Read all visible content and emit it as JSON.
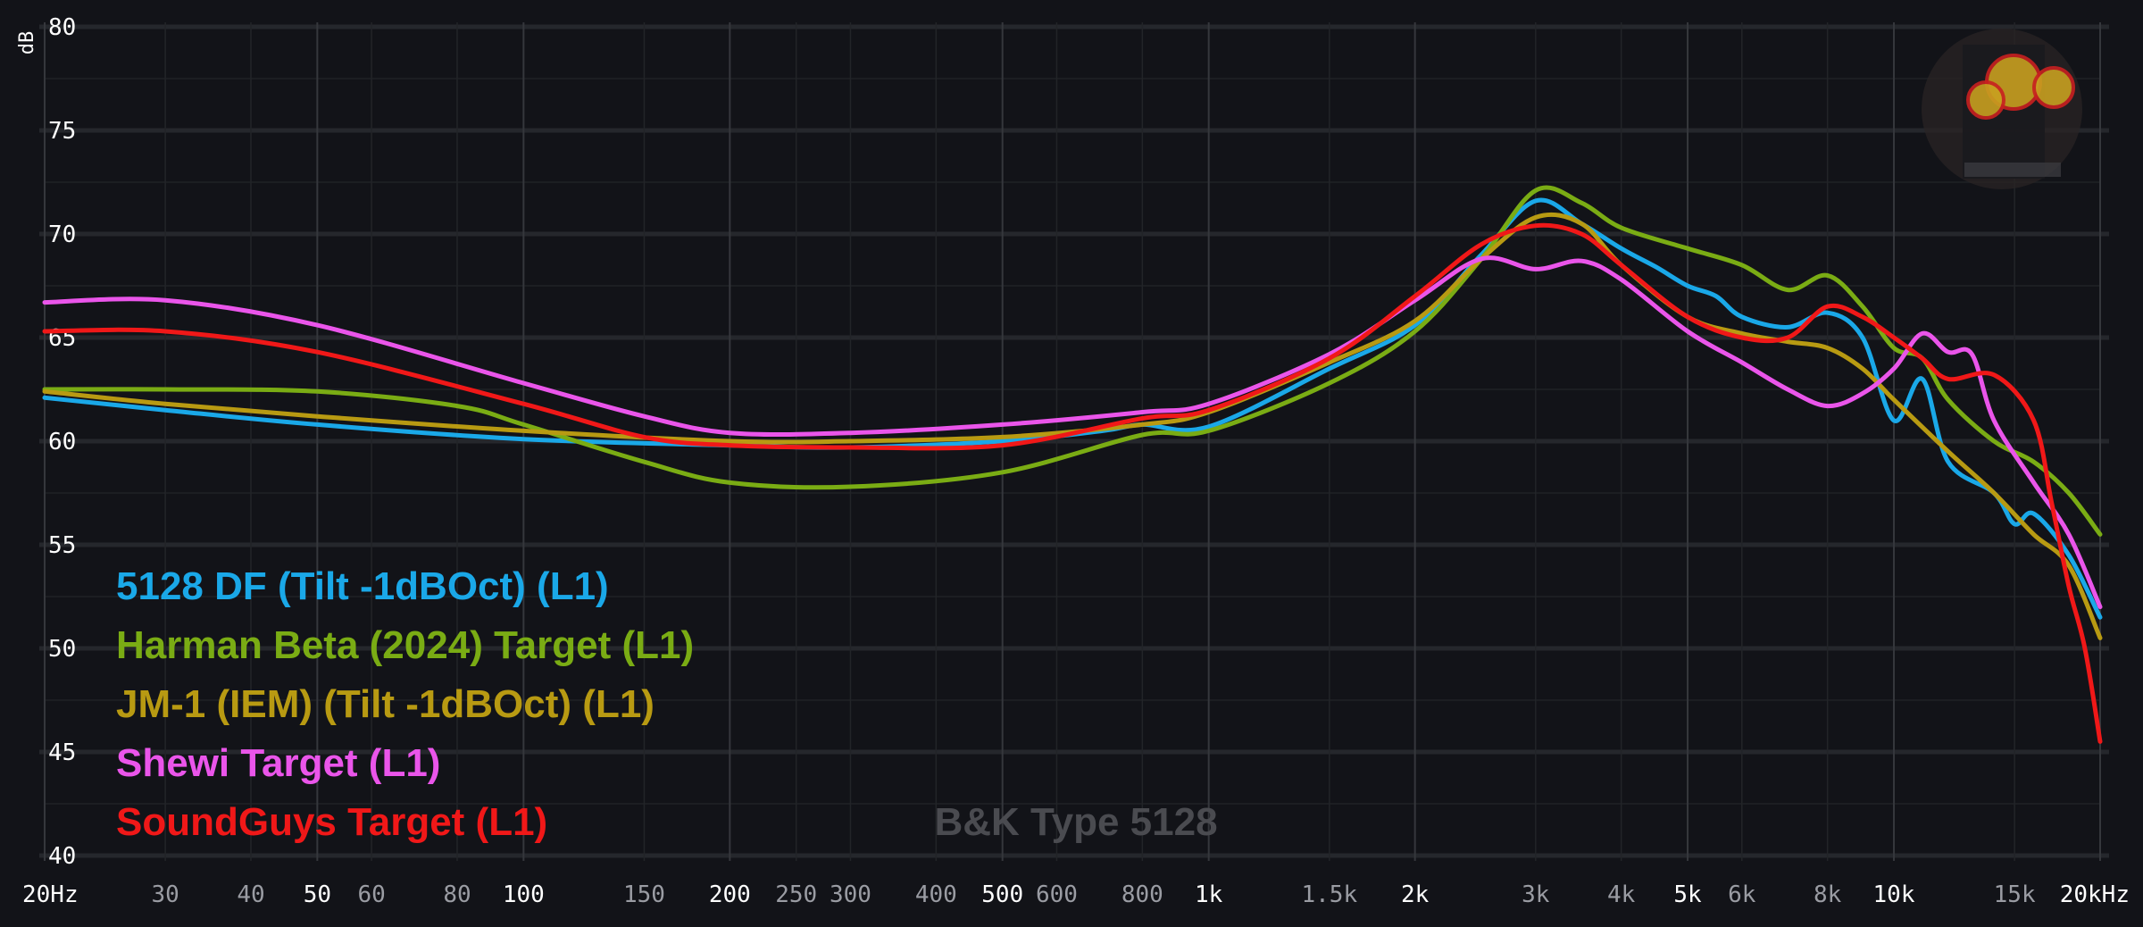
{
  "chart_data": {
    "type": "line",
    "x_scale": "log",
    "xlim": [
      20,
      20000
    ],
    "ylim": [
      40,
      80
    ],
    "y_unit": "dB",
    "yticks": [
      40,
      45,
      50,
      55,
      60,
      65,
      70,
      75,
      80
    ],
    "xticks": [
      {
        "value": 20,
        "label": "20Hz",
        "major": true
      },
      {
        "value": 30,
        "label": "30",
        "major": false
      },
      {
        "value": 40,
        "label": "40",
        "major": false
      },
      {
        "value": 50,
        "label": "50",
        "major": true
      },
      {
        "value": 60,
        "label": "60",
        "major": false
      },
      {
        "value": 80,
        "label": "80",
        "major": false
      },
      {
        "value": 100,
        "label": "100",
        "major": true
      },
      {
        "value": 150,
        "label": "150",
        "major": false
      },
      {
        "value": 200,
        "label": "200",
        "major": true
      },
      {
        "value": 250,
        "label": "250",
        "major": false
      },
      {
        "value": 300,
        "label": "300",
        "major": false
      },
      {
        "value": 400,
        "label": "400",
        "major": false
      },
      {
        "value": 500,
        "label": "500",
        "major": true
      },
      {
        "value": 600,
        "label": "600",
        "major": false
      },
      {
        "value": 800,
        "label": "800",
        "major": false
      },
      {
        "value": 1000,
        "label": "1k",
        "major": true
      },
      {
        "value": 1500,
        "label": "1.5k",
        "major": false
      },
      {
        "value": 2000,
        "label": "2k",
        "major": true
      },
      {
        "value": 3000,
        "label": "3k",
        "major": false
      },
      {
        "value": 4000,
        "label": "4k",
        "major": false
      },
      {
        "value": 5000,
        "label": "5k",
        "major": true
      },
      {
        "value": 6000,
        "label": "6k",
        "major": false
      },
      {
        "value": 8000,
        "label": "8k",
        "major": false
      },
      {
        "value": 10000,
        "label": "10k",
        "major": true
      },
      {
        "value": 15000,
        "label": "15k",
        "major": false
      },
      {
        "value": 20000,
        "label": "20kHz",
        "major": true
      }
    ],
    "grid": true,
    "legend_position": "bottom-left",
    "annotation": "B&K Type 5128",
    "series": [
      {
        "name": "5128 DF (Tilt -1dBOct) (L1)",
        "color": "#1aa8e8",
        "points": [
          [
            20,
            62.1
          ],
          [
            30,
            61.5
          ],
          [
            50,
            60.8
          ],
          [
            100,
            60.1
          ],
          [
            200,
            59.8
          ],
          [
            300,
            59.7
          ],
          [
            500,
            60.0
          ],
          [
            700,
            60.5
          ],
          [
            800,
            60.8
          ],
          [
            1000,
            60.7
          ],
          [
            1500,
            63.5
          ],
          [
            2000,
            65.6
          ],
          [
            2500,
            69.0
          ],
          [
            3000,
            71.6
          ],
          [
            3500,
            70.5
          ],
          [
            4000,
            69.3
          ],
          [
            4500,
            68.4
          ],
          [
            5000,
            67.5
          ],
          [
            5500,
            67.0
          ],
          [
            6000,
            66.0
          ],
          [
            7000,
            65.5
          ],
          [
            8000,
            66.2
          ],
          [
            9000,
            65.0
          ],
          [
            10000,
            61.0
          ],
          [
            11000,
            63.0
          ],
          [
            12000,
            59.0
          ],
          [
            14000,
            57.5
          ],
          [
            15000,
            56.0
          ],
          [
            16000,
            56.5
          ],
          [
            18000,
            54.5
          ],
          [
            20000,
            51.5
          ]
        ]
      },
      {
        "name": "Harman Beta (2024) Target (L1)",
        "color": "#7aac14",
        "points": [
          [
            20,
            62.5
          ],
          [
            30,
            62.5
          ],
          [
            50,
            62.4
          ],
          [
            80,
            61.7
          ],
          [
            100,
            60.8
          ],
          [
            150,
            59.0
          ],
          [
            200,
            58.0
          ],
          [
            300,
            57.8
          ],
          [
            500,
            58.5
          ],
          [
            800,
            60.3
          ],
          [
            1000,
            60.5
          ],
          [
            1500,
            62.8
          ],
          [
            2000,
            65.3
          ],
          [
            2500,
            68.8
          ],
          [
            3000,
            72.1
          ],
          [
            3500,
            71.5
          ],
          [
            4000,
            70.3
          ],
          [
            5000,
            69.3
          ],
          [
            6000,
            68.5
          ],
          [
            7000,
            67.3
          ],
          [
            8000,
            68.0
          ],
          [
            9000,
            66.5
          ],
          [
            10000,
            64.5
          ],
          [
            11000,
            64.0
          ],
          [
            12000,
            62.0
          ],
          [
            14000,
            60.0
          ],
          [
            16000,
            59.0
          ],
          [
            18000,
            57.5
          ],
          [
            20000,
            55.5
          ]
        ]
      },
      {
        "name": "JM-1 (IEM) (Tilt -1dBOct) (L1)",
        "color": "#b89a12",
        "points": [
          [
            20,
            62.4
          ],
          [
            30,
            61.8
          ],
          [
            50,
            61.2
          ],
          [
            100,
            60.5
          ],
          [
            200,
            60.0
          ],
          [
            300,
            60.0
          ],
          [
            500,
            60.2
          ],
          [
            800,
            60.8
          ],
          [
            1000,
            61.4
          ],
          [
            1500,
            63.8
          ],
          [
            2000,
            65.8
          ],
          [
            2500,
            68.8
          ],
          [
            3000,
            70.8
          ],
          [
            3500,
            70.5
          ],
          [
            4000,
            68.5
          ],
          [
            5000,
            66.0
          ],
          [
            6000,
            65.2
          ],
          [
            7000,
            64.8
          ],
          [
            8000,
            64.5
          ],
          [
            9000,
            63.5
          ],
          [
            10000,
            62.0
          ],
          [
            12000,
            59.5
          ],
          [
            14000,
            57.5
          ],
          [
            16000,
            55.5
          ],
          [
            18000,
            54.0
          ],
          [
            20000,
            50.5
          ]
        ]
      },
      {
        "name": "Shewi Target (L1)",
        "color": "#ea55ea",
        "points": [
          [
            20,
            66.7
          ],
          [
            30,
            66.8
          ],
          [
            50,
            65.6
          ],
          [
            100,
            62.8
          ],
          [
            150,
            61.2
          ],
          [
            200,
            60.4
          ],
          [
            300,
            60.4
          ],
          [
            500,
            60.8
          ],
          [
            800,
            61.4
          ],
          [
            1000,
            61.8
          ],
          [
            1500,
            64.2
          ],
          [
            2000,
            66.8
          ],
          [
            2500,
            68.8
          ],
          [
            3000,
            68.3
          ],
          [
            3500,
            68.7
          ],
          [
            4000,
            67.8
          ],
          [
            5000,
            65.3
          ],
          [
            6000,
            63.8
          ],
          [
            7000,
            62.5
          ],
          [
            8000,
            61.7
          ],
          [
            9000,
            62.3
          ],
          [
            10000,
            63.5
          ],
          [
            11000,
            65.2
          ],
          [
            12000,
            64.3
          ],
          [
            13000,
            64.2
          ],
          [
            14000,
            61.0
          ],
          [
            16000,
            58.0
          ],
          [
            18000,
            55.5
          ],
          [
            20000,
            52.0
          ]
        ]
      },
      {
        "name": "SoundGuys Target (L1)",
        "color": "#f01818",
        "points": [
          [
            20,
            65.3
          ],
          [
            30,
            65.3
          ],
          [
            50,
            64.3
          ],
          [
            100,
            61.8
          ],
          [
            150,
            60.2
          ],
          [
            200,
            59.8
          ],
          [
            300,
            59.7
          ],
          [
            500,
            59.8
          ],
          [
            800,
            61.1
          ],
          [
            1000,
            61.5
          ],
          [
            1500,
            64.0
          ],
          [
            2000,
            67.0
          ],
          [
            2500,
            69.5
          ],
          [
            3000,
            70.4
          ],
          [
            3500,
            70.0
          ],
          [
            4000,
            68.5
          ],
          [
            5000,
            66.0
          ],
          [
            6000,
            65.0
          ],
          [
            7000,
            65.0
          ],
          [
            8000,
            66.5
          ],
          [
            9000,
            66.0
          ],
          [
            10000,
            65.0
          ],
          [
            11000,
            64.0
          ],
          [
            12000,
            63.0
          ],
          [
            14000,
            63.2
          ],
          [
            16000,
            61.0
          ],
          [
            17000,
            57.0
          ],
          [
            18000,
            53.0
          ],
          [
            19000,
            50.0
          ],
          [
            20000,
            45.5
          ]
        ]
      }
    ]
  }
}
